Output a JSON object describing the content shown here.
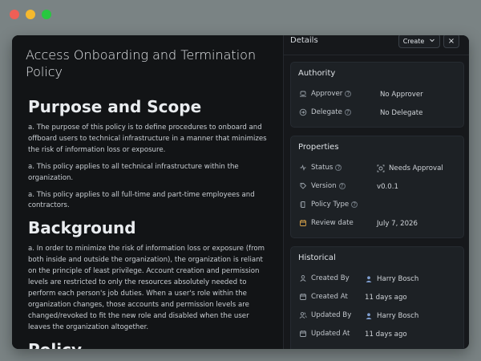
{
  "document": {
    "title": "Access Onboarding and Termination Policy",
    "sections": [
      {
        "heading": "Purpose and Scope",
        "paragraphs": [
          "a. The purpose of this policy is to define procedures to onboard and offboard users to technical infrastructure in a manner that minimizes the risk of information loss or exposure.",
          "a. This policy applies to all technical infrastructure within the organization.",
          "a. This policy applies to all full-time and part-time employees and contractors."
        ]
      },
      {
        "heading": "Background",
        "paragraphs": [
          "a. In order to minimize the risk of information loss or exposure (from both inside and outside the organization), the organization is reliant on the principle of least privilege. Account creation and permission levels are restricted to only the resources absolutely needed to perform each person's job duties. When a user's role within the organization changes, those accounts and permission levels are changed/revoked to fit the new role and disabled when the user leaves the organization altogether."
        ]
      },
      {
        "heading": "Policy",
        "paragraphs": []
      }
    ]
  },
  "details_panel": {
    "title": "Details",
    "create_label": "Create",
    "close_label": "×",
    "authority": {
      "title": "Authority",
      "approver_label": "Approver",
      "approver_value": "No Approver",
      "delegate_label": "Delegate",
      "delegate_value": "No Delegate"
    },
    "properties": {
      "title": "Properties",
      "status_label": "Status",
      "status_value": "Needs Approval",
      "version_label": "Version",
      "version_value": "v0.0.1",
      "policy_type_label": "Policy Type",
      "review_date_label": "Review date",
      "review_date_value": "July 7, 2026"
    },
    "historical": {
      "title": "Historical",
      "created_by_label": "Created By",
      "created_by_value": "Harry Bosch",
      "created_at_label": "Created At",
      "created_at_value": "11 days ago",
      "updated_by_label": "Updated By",
      "updated_by_value": "Harry Bosch",
      "updated_at_label": "Updated At",
      "updated_at_value": "11 days ago"
    }
  },
  "icons": {
    "window_controls": [
      "close-dot",
      "minimize-dot",
      "maximize-dot"
    ],
    "create_chevron": "chevron-down-icon",
    "help": "help-circle-icon"
  },
  "colors": {
    "window_bg": "#17191c",
    "document_bg": "#121416",
    "card_bg": "#1d2125",
    "text": "#c9ced3"
  }
}
